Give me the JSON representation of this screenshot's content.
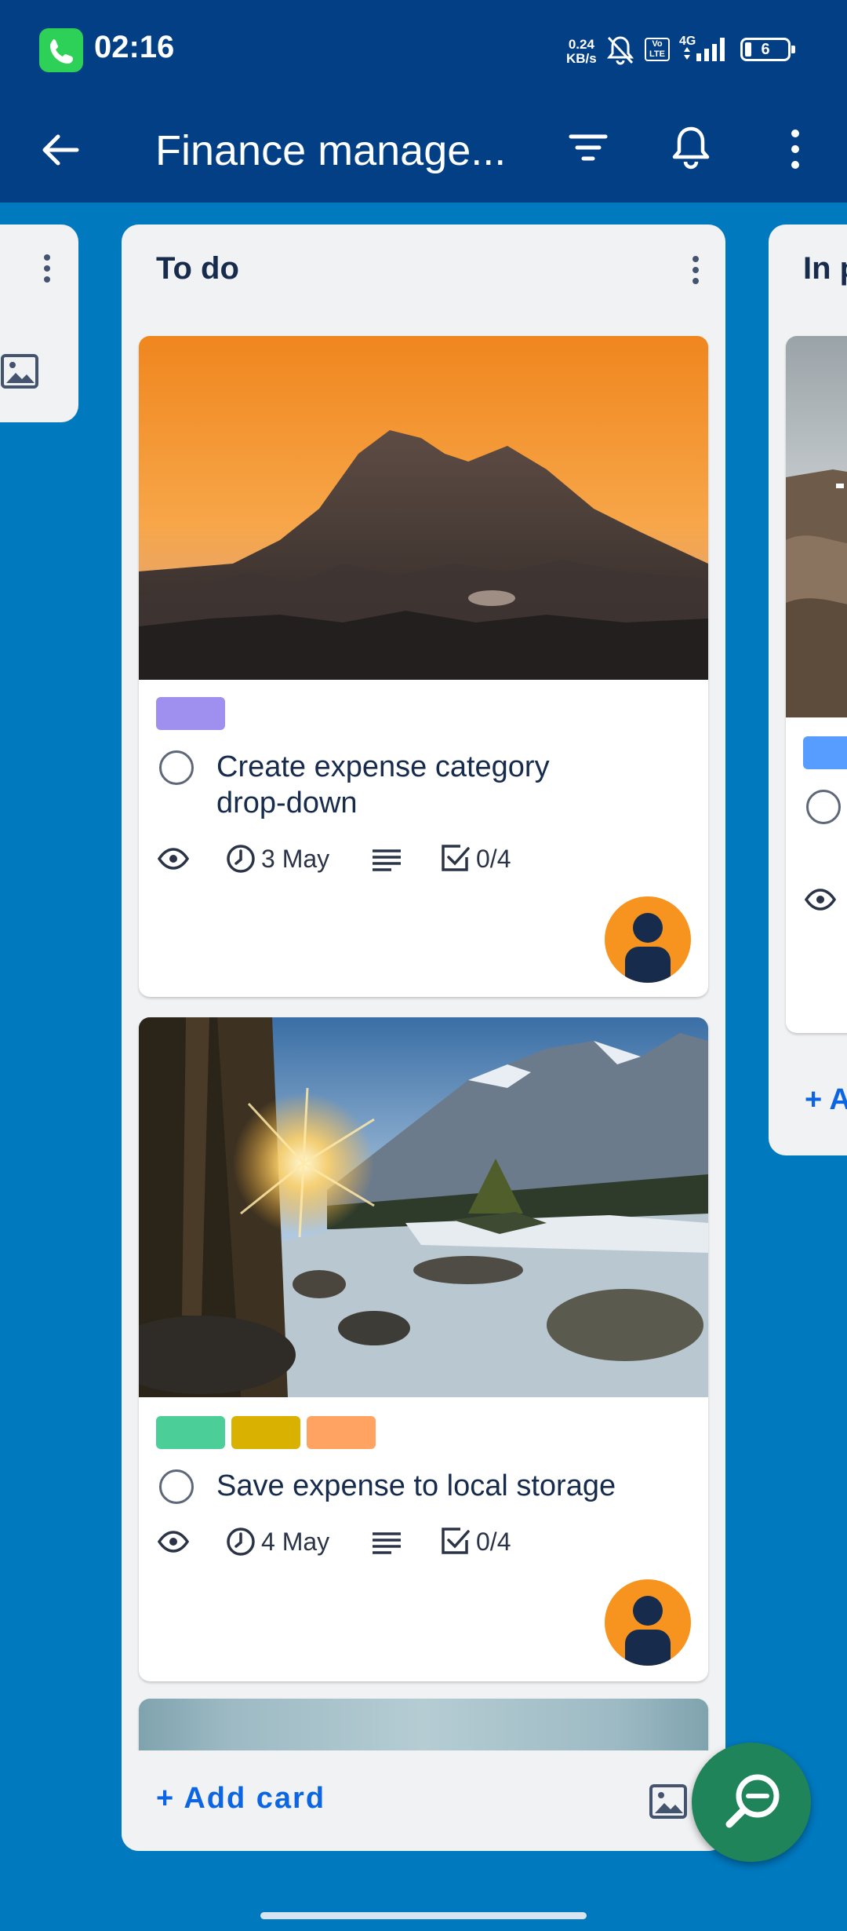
{
  "status_bar": {
    "time": "02:16",
    "net_speed_top": "0.24",
    "net_speed_bottom": "KB/s",
    "network": "4G",
    "battery": "6",
    "volte": "Vo LTE"
  },
  "app_bar": {
    "title": "Finance manage...",
    "icons": [
      "back-arrow-icon",
      "filter-icon",
      "bell-icon",
      "more-vert-icon"
    ]
  },
  "columns": {
    "todo": {
      "title": "To do",
      "add_card": "+ Add card"
    },
    "next": {
      "title": "In p",
      "add_card": "+ A"
    }
  },
  "cards": [
    {
      "title_line1": "Create expense category",
      "title_line2": "drop-down",
      "date": "3 May",
      "checklist": "0/4",
      "label_colors": [
        "#9F8FEF"
      ]
    },
    {
      "title_line1": "Save expense to local storage",
      "date": "4 May",
      "checklist": "0/4",
      "label_colors": [
        "#4BCE97",
        "#D9B100",
        "#FEA362"
      ]
    }
  ],
  "colors": {
    "header": "#023F85",
    "board_bg": "#0079BF",
    "fab": "#1F845A",
    "avatar": "#F7941F",
    "link": "#0C66E4"
  }
}
